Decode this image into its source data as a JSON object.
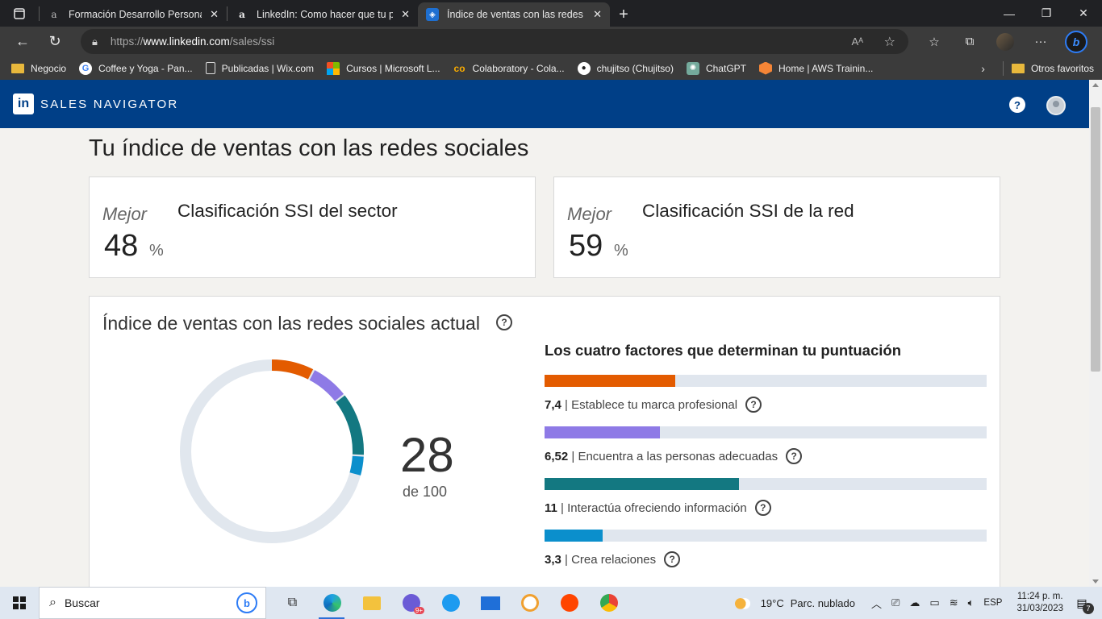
{
  "browser": {
    "tabs": [
      {
        "title": "Formación Desarrollo Personal G",
        "icon": "a-icon",
        "active": false
      },
      {
        "title": "LinkedIn: Como hacer que tu per",
        "icon": "a-icon",
        "active": false
      },
      {
        "title": "Índice de ventas con las redes so",
        "icon": "compass-icon",
        "active": true
      }
    ],
    "url_prefix": "https://",
    "url_host": "www.linkedin.com",
    "url_path": "/sales/ssi",
    "favorites": [
      {
        "label": "Negocio",
        "icon": "folder-icon"
      },
      {
        "label": "Coffee y Yoga - Pan...",
        "icon": "google-icon"
      },
      {
        "label": "Publicadas | Wix.com",
        "icon": "page-icon"
      },
      {
        "label": "Cursos | Microsoft L...",
        "icon": "microsoft-icon"
      },
      {
        "label": "Colaboratory - Cola...",
        "icon": "colab-icon"
      },
      {
        "label": "chujitso (Chujitso)",
        "icon": "github-icon"
      },
      {
        "label": "ChatGPT",
        "icon": "chatgpt-icon"
      },
      {
        "label": "Home | AWS Trainin...",
        "icon": "aws-icon"
      }
    ],
    "other_favorites": "Otros favoritos"
  },
  "header": {
    "logo": "in",
    "title": "SALES NAVIGATOR"
  },
  "page": {
    "title": "Tu índice de ventas con las redes sociales",
    "ranks": [
      {
        "prefix": "Mejor",
        "value": "48",
        "unit": "%",
        "label": "Clasificación SSI del sector"
      },
      {
        "prefix": "Mejor",
        "value": "59",
        "unit": "%",
        "label": "Clasificación SSI de la red"
      }
    ],
    "ssi": {
      "heading": "Índice de ventas con las redes sociales actual",
      "score": "28",
      "score_sub": "de 100",
      "factors_title": "Los cuatro factores que determinan tu puntuación",
      "factors": [
        {
          "value": "7,4",
          "label": "Establece tu marca profesional",
          "color": "#e35b00",
          "fraction": 0.296
        },
        {
          "value": "6,52",
          "label": "Encuentra a las personas adecuadas",
          "color": "#8e7ae6",
          "fraction": 0.261
        },
        {
          "value": "11",
          "label": "Interactúa ofreciendo información",
          "color": "#137881",
          "fraction": 0.44
        },
        {
          "value": "3,3",
          "label": "Crea relaciones",
          "color": "#0b8fcc",
          "fraction": 0.132
        }
      ],
      "donut_track_color": "#e1e7ee"
    }
  },
  "taskbar": {
    "search_label": "Buscar",
    "weather_temp": "19°C",
    "weather_desc": "Parc. nublado",
    "language": "ESP",
    "time": "11:24 p. m.",
    "date": "31/03/2023",
    "notification_count": "7",
    "app_badge": "9+"
  }
}
